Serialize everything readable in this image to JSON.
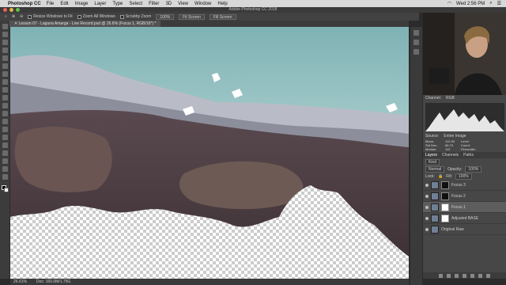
{
  "menubar": {
    "app_name": "Photoshop CC",
    "items": [
      "File",
      "Edit",
      "Image",
      "Layer",
      "Type",
      "Select",
      "Filter",
      "3D",
      "View",
      "Window",
      "Help"
    ],
    "clock": "Wed 2:56 PM"
  },
  "window": {
    "title": "Adobe Photoshop CC 2018"
  },
  "options": {
    "resize_windows": "Resize Windows to Fit",
    "zoom_all": "Zoom All Windows",
    "scrubby_zoom": "Scrubby Zoom",
    "zoom_level": "100%",
    "fit_screen": "Fit Screen",
    "fill_screen": "Fill Screen"
  },
  "document": {
    "tab_title": "Lesson 07 - Laguna Amarga - Live Record.psd @ 26.6% (Focus 1, RGB/16*) *",
    "zoom": "26.61%",
    "doc_size": "Doc: 160.0M/1.75G"
  },
  "histogram": {
    "channel_label": "Channel:",
    "channel_value": "RGB",
    "source_label": "Source:",
    "source_value": "Entire Image",
    "stats": [
      [
        "Mean:",
        "112.69",
        "Level:",
        ""
      ],
      [
        "Std Dev:",
        "66.79",
        "Count:",
        ""
      ],
      [
        "Median:",
        "112",
        "Percentile:",
        ""
      ],
      [
        "Pixels:",
        "795798",
        "Cache Level:",
        "4"
      ]
    ]
  },
  "layers": {
    "tabs": [
      "Layers",
      "Channels",
      "Paths"
    ],
    "kind": "Kind",
    "blend_mode": "Normal",
    "opacity_label": "Opacity:",
    "opacity": "100%",
    "lock_label": "Lock:",
    "fill_label": "Fill:",
    "fill": "100%",
    "rows": [
      {
        "name": "Focus 3",
        "mask": "black"
      },
      {
        "name": "Focus 2",
        "mask": "black"
      },
      {
        "name": "Focus 1",
        "mask": "white"
      },
      {
        "name": "Adjusted BASE",
        "mask": "white"
      },
      {
        "name": "Original Raw",
        "mask": "none"
      }
    ]
  },
  "colors": {
    "sea": "#8fbdbd",
    "rock": "#4a3a3e",
    "ui_bg": "#424242"
  }
}
